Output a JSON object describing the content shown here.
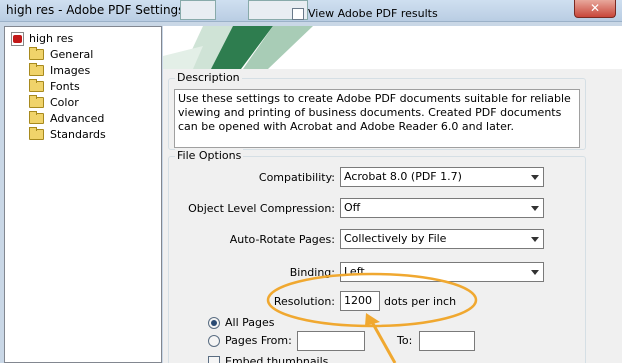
{
  "window": {
    "title": "high res - Adobe PDF Settings",
    "close_glyph": "✕"
  },
  "background_window": {
    "checkbox_label": "View Adobe PDF results"
  },
  "tree": {
    "root": "high res",
    "items": [
      {
        "label": "General",
        "icon": "folder-icon"
      },
      {
        "label": "Images",
        "icon": "folder-icon"
      },
      {
        "label": "Fonts",
        "icon": "folder-icon"
      },
      {
        "label": "Color",
        "icon": "folder-icon"
      },
      {
        "label": "Advanced",
        "icon": "folder-icon"
      },
      {
        "label": "Standards",
        "icon": "folder-icon"
      }
    ]
  },
  "description": {
    "title": "Description",
    "text": "Use these settings to create Adobe PDF documents suitable for reliable viewing and printing of business documents.  Created PDF documents can be opened with Acrobat and Adobe Reader 6.0 and later."
  },
  "file_options": {
    "title": "File Options",
    "compatibility": {
      "label": "Compatibility:",
      "value": "Acrobat 8.0 (PDF 1.7)"
    },
    "object_compression": {
      "label": "Object Level Compression:",
      "value": "Off"
    },
    "auto_rotate": {
      "label": "Auto-Rotate Pages:",
      "value": "Collectively by File"
    },
    "binding": {
      "label": "Binding:",
      "value": "Left"
    },
    "resolution": {
      "label": "Resolution:",
      "value": "1200",
      "unit": "dots per inch"
    },
    "pages": {
      "all_label": "All Pages",
      "from_label": "Pages From:",
      "to_label": "To:",
      "from_value": "",
      "to_value": "",
      "selected": "all"
    },
    "embed_thumbnails": "Embed thumbnails"
  },
  "colors": {
    "annotation": "#f0a830",
    "banner_accent": "#2e7d4f"
  }
}
